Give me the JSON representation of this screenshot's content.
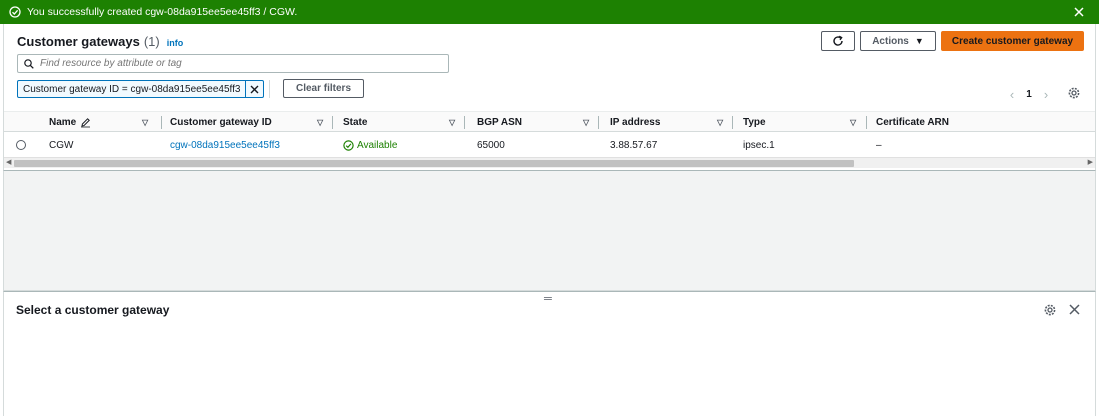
{
  "flash": {
    "message": "You successfully created cgw-08da915ee5ee45ff3 / CGW.",
    "color": "#1d8102"
  },
  "header": {
    "title": "Customer gateways",
    "count": "(1)",
    "info": "info"
  },
  "toolbar": {
    "actions_label": "Actions",
    "create_label": "Create customer gateway"
  },
  "search": {
    "placeholder": "Find resource by attribute or tag"
  },
  "filter": {
    "token": "Customer gateway ID = cgw-08da915ee5ee45ff3",
    "clear_label": "Clear filters"
  },
  "pagination": {
    "current_page": "1"
  },
  "table": {
    "columns": [
      "Name",
      "Customer gateway ID",
      "State",
      "BGP ASN",
      "IP address",
      "Type",
      "Certificate ARN"
    ],
    "rows": [
      {
        "name": "CGW",
        "id": "cgw-08da915ee5ee45ff3",
        "state": "Available",
        "bgp_asn": "65000",
        "ip": "3.88.57.67",
        "type": "ipsec.1",
        "cert": "–"
      }
    ]
  },
  "detail": {
    "title": "Select a customer gateway"
  },
  "colors": {
    "accent": "#ec7211",
    "link": "#0073bb",
    "success": "#1d8102"
  }
}
